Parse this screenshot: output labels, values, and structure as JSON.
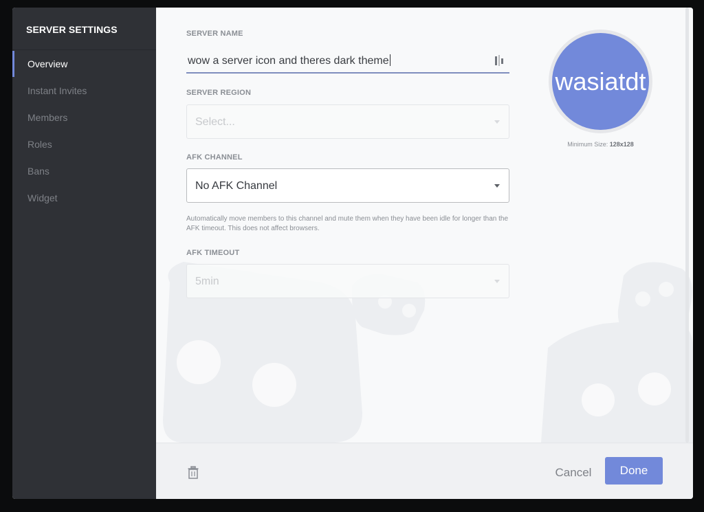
{
  "sidebar": {
    "title": "SERVER SETTINGS",
    "items": [
      {
        "label": "Overview",
        "active": true
      },
      {
        "label": "Instant Invites",
        "active": false
      },
      {
        "label": "Members",
        "active": false
      },
      {
        "label": "Roles",
        "active": false
      },
      {
        "label": "Bans",
        "active": false
      },
      {
        "label": "Widget",
        "active": false
      }
    ]
  },
  "form": {
    "server_name": {
      "label": "SERVER NAME",
      "value": "wow a server icon and theres dark theme",
      "icon": "emoji-picker-icon"
    },
    "server_region": {
      "label": "SERVER REGION",
      "placeholder": "Select..."
    },
    "afk_channel": {
      "label": "AFK CHANNEL",
      "value": "No AFK Channel",
      "help": "Automatically move members to this channel and mute them when they have been idle for longer than the AFK timeout. This does not affect browsers."
    },
    "afk_timeout": {
      "label": "AFK TIMEOUT",
      "value": "5min"
    }
  },
  "icon": {
    "avatar_text": "wasiatdt",
    "min_size_label": "Minimum Size:",
    "min_size_value": "128x128"
  },
  "footer": {
    "cancel_label": "Cancel",
    "done_label": "Done",
    "delete_icon": "trash-icon"
  },
  "colors": {
    "accent": "#7289da",
    "sidebar_bg": "#2f3136",
    "content_bg": "#f8f9fa"
  }
}
